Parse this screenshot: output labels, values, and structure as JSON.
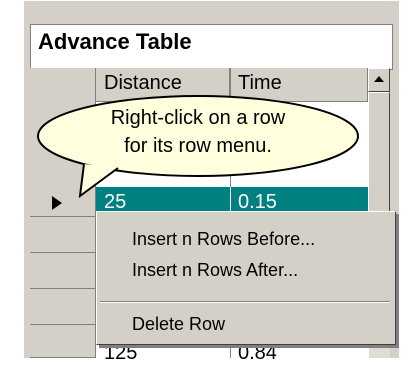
{
  "panel": {
    "title": "Advance Table"
  },
  "grid": {
    "columns": [
      "Distance",
      "Time"
    ],
    "selected_row": {
      "distance": "25",
      "time": "0.15"
    },
    "bottom_row": {
      "distance": "125",
      "time": "0.84"
    }
  },
  "callout": {
    "line1": "Right-click on a row",
    "line2": "for its row menu."
  },
  "context_menu": {
    "items": [
      "Insert n Rows Before...",
      "Insert n Rows After...",
      "Delete Row"
    ]
  },
  "colors": {
    "selection": "#008080",
    "bubble": "#ffffdd",
    "window": "#d4d0c8"
  },
  "icons": {
    "row_indicator": "triangle-right",
    "scroll_up": "triangle-up"
  }
}
